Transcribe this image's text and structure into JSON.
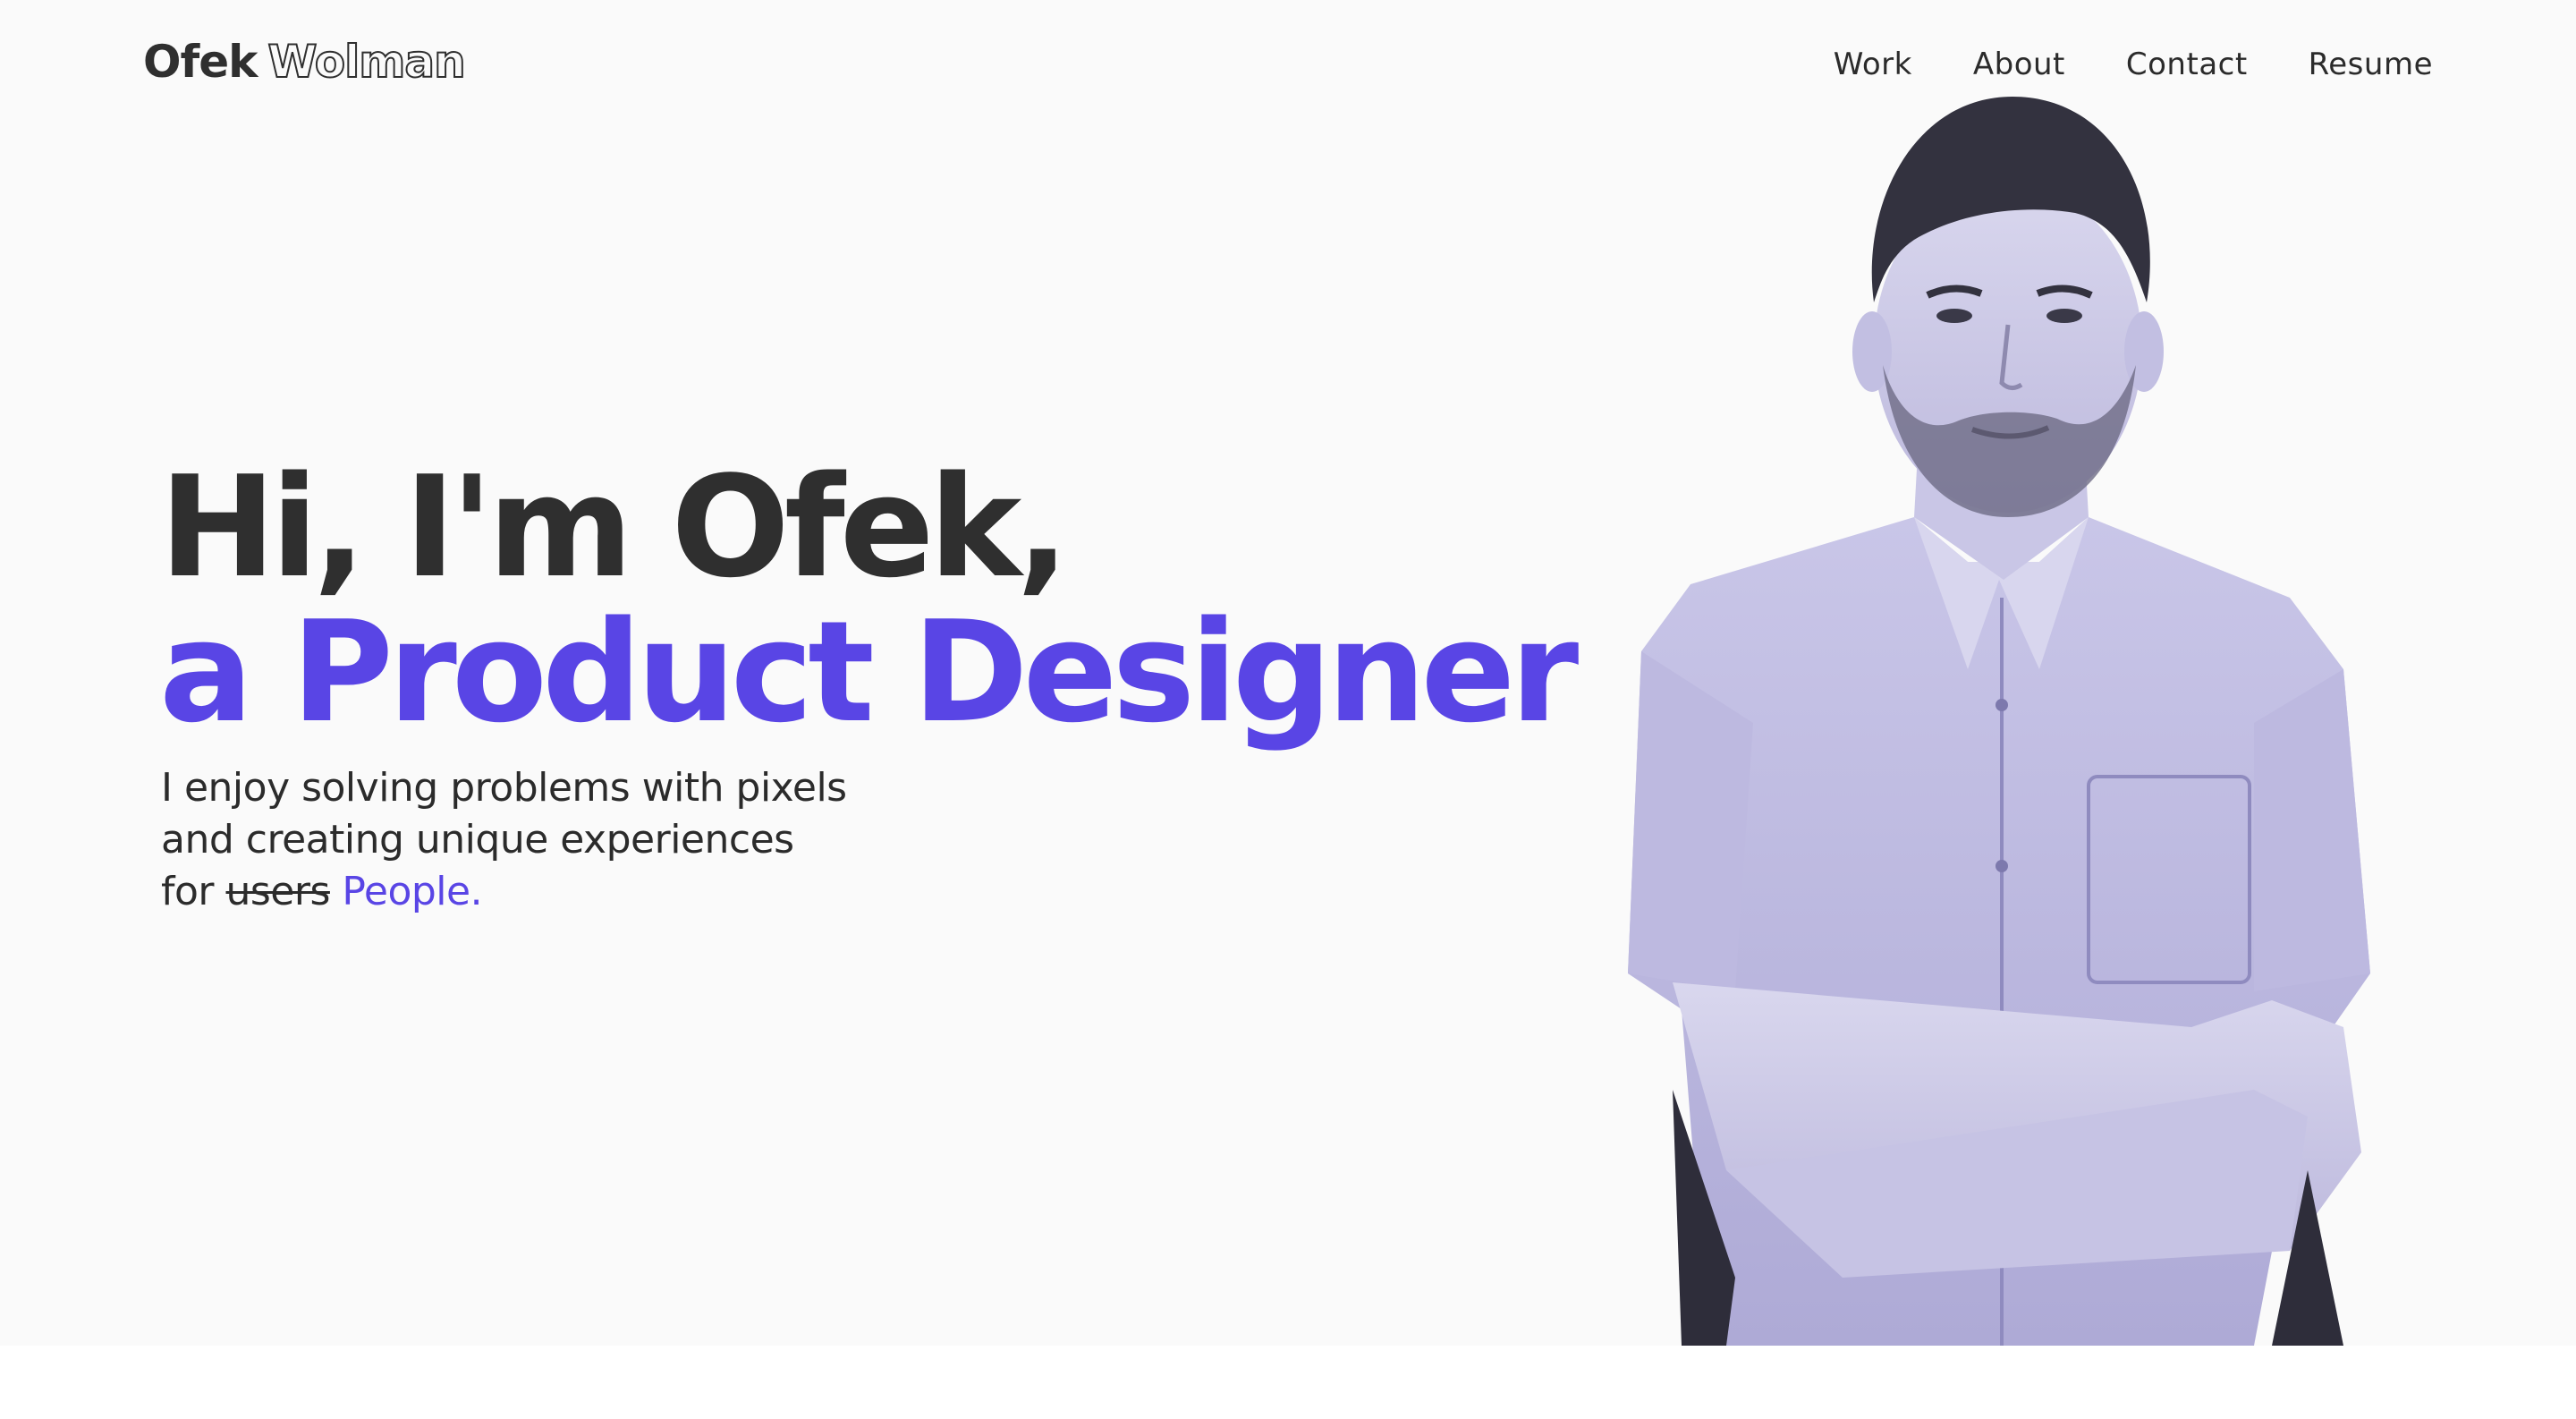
{
  "header": {
    "logo_first": "Ofek",
    "logo_last": "Wolman",
    "nav": [
      {
        "label": "Work"
      },
      {
        "label": "About"
      },
      {
        "label": "Contact"
      },
      {
        "label": "Resume"
      }
    ]
  },
  "hero": {
    "headline_line1": "Hi, I'm Ofek,",
    "headline_line2": "a Product Designer",
    "tagline_line1": "I enjoy solving problems with pixels",
    "tagline_line2": "and creating unique experiences",
    "tagline_for": "for",
    "tagline_struck": "users",
    "tagline_accent": "People."
  },
  "portrait": {
    "icon": "person-portrait",
    "tint": "#b9b6dd"
  },
  "colors": {
    "accent": "#5945e5",
    "text": "#2f2f2f",
    "background": "#fafafa"
  }
}
